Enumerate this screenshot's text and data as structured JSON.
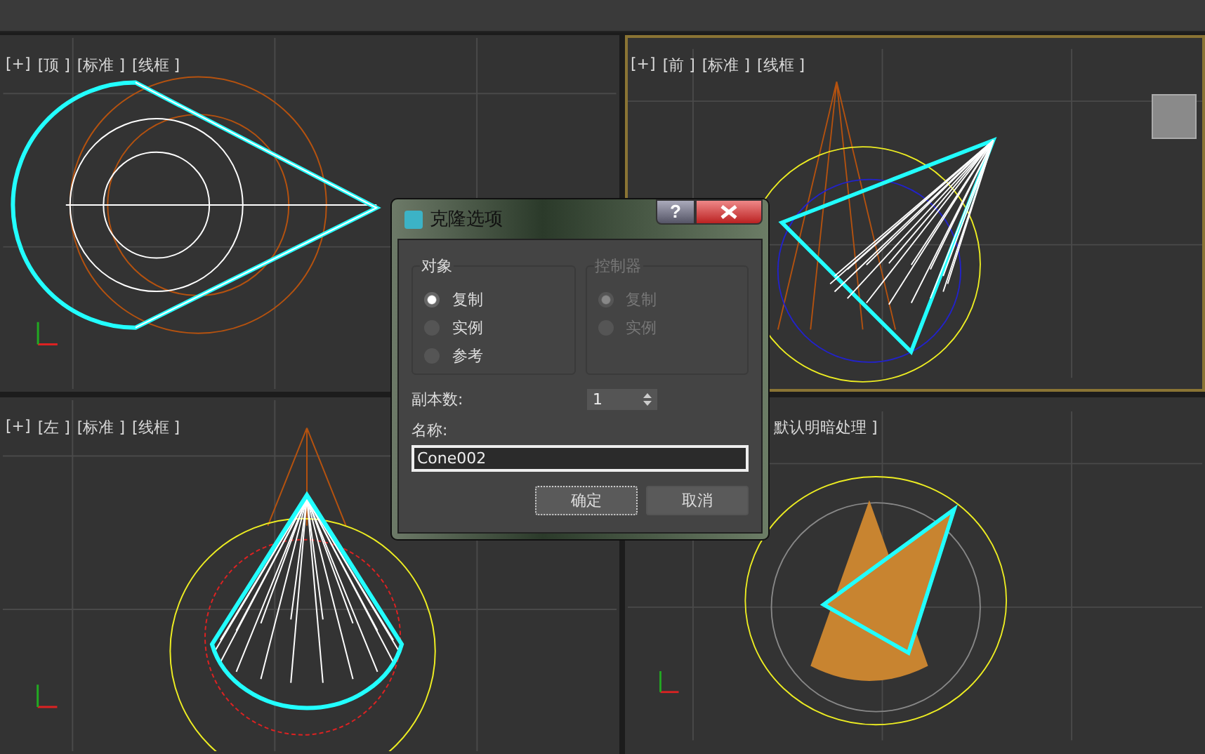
{
  "viewports": [
    {
      "kind": "top",
      "active": false,
      "labels": [
        "[+]",
        "[顶 ]",
        "[标准 ]",
        "[线框 ]"
      ]
    },
    {
      "kind": "front",
      "active": true,
      "labels": [
        "[+]",
        "[前 ]",
        "[标准 ]",
        "[线框 ]"
      ]
    },
    {
      "kind": "left",
      "active": false,
      "labels": [
        "[+]",
        "[左 ]",
        "[标准 ]",
        "[线框 ]"
      ]
    },
    {
      "kind": "perspective",
      "active": false,
      "labels": [
        "默认明暗处理 ]"
      ]
    }
  ],
  "dialog": {
    "title": "克隆选项",
    "help_button": "?",
    "groups": [
      {
        "title": "对象",
        "disabled": false,
        "options": [
          {
            "label": "复制",
            "selected": true
          },
          {
            "label": "实例",
            "selected": false
          },
          {
            "label": "参考",
            "selected": false
          }
        ]
      },
      {
        "title": "控制器",
        "disabled": true,
        "options": [
          {
            "label": "复制",
            "selected": true
          },
          {
            "label": "实例",
            "selected": false
          }
        ]
      }
    ],
    "copies": {
      "label": "副本数:",
      "value": "1"
    },
    "name": {
      "label": "名称:",
      "value": "Cone002"
    },
    "buttons": [
      {
        "label": "确定",
        "focused": true
      },
      {
        "label": "取消",
        "focused": false
      }
    ]
  }
}
